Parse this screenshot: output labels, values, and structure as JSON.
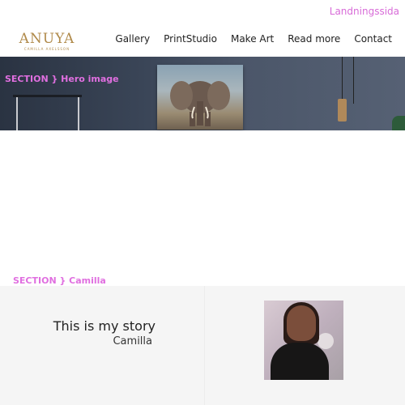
{
  "top_link": "Landningssida",
  "logo": {
    "name": "ANUYA",
    "subtitle": "CAMILLA AXELSSON"
  },
  "nav": [
    "Gallery",
    "PrintStudio",
    "Make Art",
    "Read more",
    "Contact"
  ],
  "hero": {
    "label": "SECTION } Hero image"
  },
  "section2": {
    "label": "SECTION } Camilla"
  },
  "story": {
    "title": "This is my story",
    "subtitle": "Camilla"
  },
  "colors": {
    "accent": "#e06fe0",
    "logo": "#b08a4a"
  }
}
